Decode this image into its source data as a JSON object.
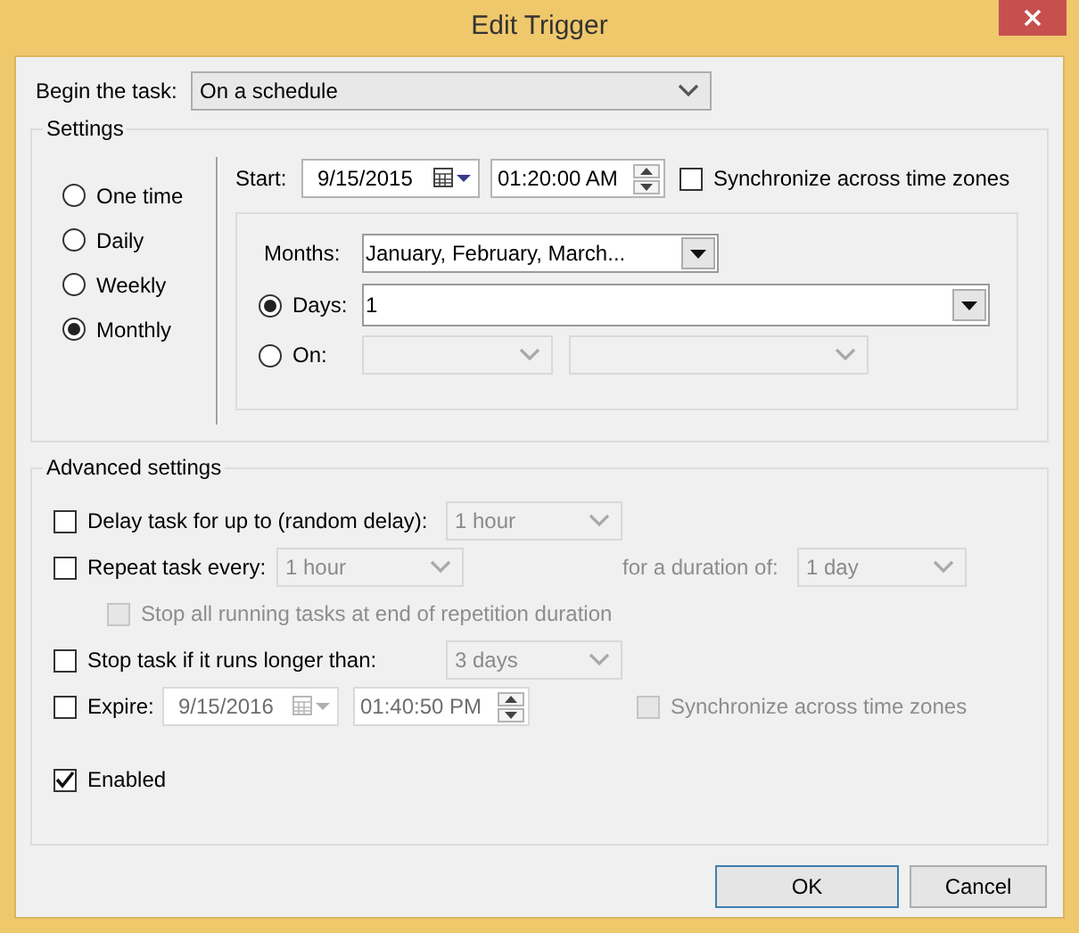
{
  "window": {
    "title": "Edit Trigger"
  },
  "begin_task": {
    "label": "Begin the task:",
    "value": "On a schedule"
  },
  "settings": {
    "title": "Settings",
    "schedule": [
      {
        "label": "One time",
        "selected": false
      },
      {
        "label": "Daily",
        "selected": false
      },
      {
        "label": "Weekly",
        "selected": false
      },
      {
        "label": "Monthly",
        "selected": true
      }
    ],
    "start": {
      "label": "Start:",
      "date": "9/15/2015",
      "time": "01:20:00 AM"
    },
    "sync": {
      "label": "Synchronize across time zones",
      "checked": false
    },
    "months": {
      "label": "Months:",
      "value": "January, February, March..."
    },
    "monthly_mode": [
      {
        "kind": "days",
        "label": "Days:",
        "selected": true,
        "value": "1"
      },
      {
        "kind": "on",
        "label": "On:",
        "selected": false
      }
    ]
  },
  "advanced": {
    "title": "Advanced settings",
    "options": [
      {
        "kind": "delay",
        "label": "Delay task for up to (random delay):",
        "checked": false,
        "value": "1 hour"
      },
      {
        "kind": "repeat",
        "label": "Repeat task every:",
        "checked": false,
        "value": "1 hour",
        "duration_label": "for a duration of:",
        "duration_value": "1 day"
      },
      {
        "kind": "stop_all",
        "label": "Stop all running tasks at end of repetition duration",
        "checked": false,
        "disabled": true
      },
      {
        "kind": "stop",
        "label": "Stop task if it runs longer than:",
        "checked": false,
        "value": "3 days"
      },
      {
        "kind": "expire",
        "label": "Expire:",
        "checked": false,
        "date": "9/15/2016",
        "time": "01:40:50 PM",
        "sync_label": "Synchronize across time zones",
        "sync_checked": false
      },
      {
        "kind": "enabled",
        "label": "Enabled",
        "checked": true
      }
    ]
  },
  "buttons": [
    {
      "label": "OK",
      "default": true
    },
    {
      "label": "Cancel",
      "default": false
    }
  ]
}
